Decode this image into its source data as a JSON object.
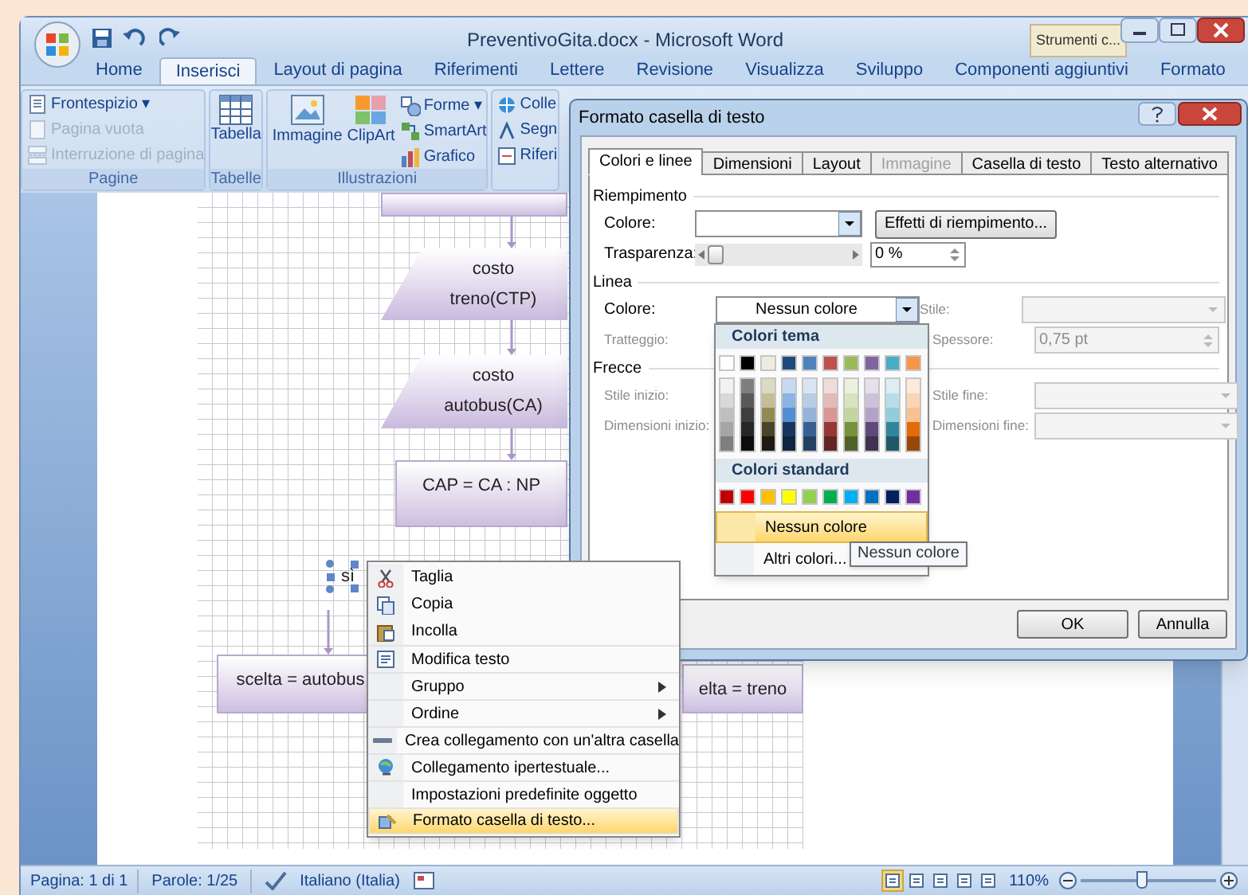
{
  "window": {
    "title": "PreventivoGita.docx - Microsoft Word",
    "contextual_tab": "Strumenti c..."
  },
  "ribbon_tabs": [
    {
      "label": "Home",
      "selected": false
    },
    {
      "label": "Inserisci",
      "selected": true
    },
    {
      "label": "Layout di pagina",
      "selected": false
    },
    {
      "label": "Riferimenti",
      "selected": false
    },
    {
      "label": "Lettere",
      "selected": false
    },
    {
      "label": "Revisione",
      "selected": false
    },
    {
      "label": "Visualizza",
      "selected": false
    },
    {
      "label": "Sviluppo",
      "selected": false
    },
    {
      "label": "Componenti aggiuntivi",
      "selected": false
    },
    {
      "label": "Formato",
      "selected": false
    }
  ],
  "ribbon_groups": [
    {
      "name": "Pagine",
      "items": [
        {
          "label": "Frontespizio ▾",
          "disabled": false
        },
        {
          "label": "Pagina vuota",
          "disabled": true
        },
        {
          "label": "Interruzione di pagina",
          "disabled": true
        }
      ]
    },
    {
      "name": "Tabelle",
      "items": [
        {
          "label": "Tabella"
        }
      ]
    },
    {
      "name": "Illustrazioni",
      "items": [
        {
          "label": "Immagine"
        },
        {
          "label": "ClipArt"
        },
        {
          "label": "Forme ▾"
        },
        {
          "label": "SmartArt"
        },
        {
          "label": "Grafico"
        }
      ]
    },
    {
      "items": [
        {
          "label": "Colle"
        },
        {
          "label": "Segn"
        },
        {
          "label": "Riferi"
        }
      ]
    }
  ],
  "document": {
    "shapes": [
      {
        "kind": "process"
      },
      {
        "kind": "input",
        "text": "costo treno(CTP)"
      },
      {
        "kind": "input",
        "text": "costo autobus(CA)"
      },
      {
        "kind": "process",
        "text": "CAP = CA : NP"
      },
      {
        "kind": "selected_label",
        "text": "sì"
      },
      {
        "kind": "process",
        "text": "scelta = autobus"
      },
      {
        "kind": "process",
        "text": "elta = treno"
      }
    ]
  },
  "dialog": {
    "title": "Formato casella di testo",
    "tabs": [
      {
        "label": "Colori e linee",
        "selected": true,
        "disabled": false
      },
      {
        "label": "Dimensioni",
        "selected": false,
        "disabled": false
      },
      {
        "label": "Layout",
        "selected": false,
        "disabled": false
      },
      {
        "label": "Immagine",
        "selected": false,
        "disabled": true
      },
      {
        "label": "Casella di testo",
        "selected": false,
        "disabled": false
      },
      {
        "label": "Testo alternativo",
        "selected": false,
        "disabled": false
      }
    ],
    "fill": {
      "heading": "Riempimento",
      "color_label": "Colore:",
      "effects_button": "Effetti di riempimento...",
      "transparency_label": "Trasparenza:",
      "transparency": {
        "level": 0
      },
      "transparency_value": "0 %"
    },
    "line": {
      "heading": "Linea",
      "color_label": "Colore:",
      "color_value": "Nessun colore",
      "dash_label": "Tratteggio:",
      "style_label": "Stile:",
      "weight_label": "Spessore:",
      "weight_value": "0,75 pt"
    },
    "arrows": {
      "heading": "Frecce",
      "begin_style_label": "Stile inizio:",
      "begin_size_label": "Dimensioni inizio:",
      "end_style_label": "Stile fine:",
      "end_size_label": "Dimensioni fine:"
    },
    "buttons": [
      "OK",
      "Annulla"
    ]
  },
  "color_picker": {
    "theme_heading": "Colori tema",
    "theme_colors": [
      {
        "color": "#ffffff"
      },
      {
        "color": "#000000"
      },
      {
        "color": "#eeece1"
      },
      {
        "color": "#1f497d"
      },
      {
        "color": "#4f81bd"
      },
      {
        "color": "#c0504d"
      },
      {
        "color": "#9bbb59"
      },
      {
        "color": "#8064a2"
      },
      {
        "color": "#4bacc6"
      },
      {
        "color": "#f79646"
      }
    ],
    "shade_columns": [
      [
        {
          "color": "#f2f2f2"
        },
        {
          "color": "#d8d8d8"
        },
        {
          "color": "#bfbfbf"
        },
        {
          "color": "#a5a5a5"
        },
        {
          "color": "#7f7f7f"
        }
      ],
      [
        {
          "color": "#7f7f7f"
        },
        {
          "color": "#595959"
        },
        {
          "color": "#3f3f3f"
        },
        {
          "color": "#262626"
        },
        {
          "color": "#0c0c0c"
        }
      ],
      [
        {
          "color": "#ddd9c3"
        },
        {
          "color": "#c4bd97"
        },
        {
          "color": "#938953"
        },
        {
          "color": "#494429"
        },
        {
          "color": "#1d1b10"
        }
      ],
      [
        {
          "color": "#c6d9f0"
        },
        {
          "color": "#8db3e2"
        },
        {
          "color": "#548dd4"
        },
        {
          "color": "#17365d"
        },
        {
          "color": "#0f243e"
        }
      ],
      [
        {
          "color": "#dbe5f1"
        },
        {
          "color": "#b8cce4"
        },
        {
          "color": "#95b3d7"
        },
        {
          "color": "#366092"
        },
        {
          "color": "#244061"
        }
      ],
      [
        {
          "color": "#f2dcdb"
        },
        {
          "color": "#e5b9b7"
        },
        {
          "color": "#d99694"
        },
        {
          "color": "#953734"
        },
        {
          "color": "#632423"
        }
      ],
      [
        {
          "color": "#ebf1dd"
        },
        {
          "color": "#d7e3bc"
        },
        {
          "color": "#c3d69b"
        },
        {
          "color": "#76923c"
        },
        {
          "color": "#4f6128"
        }
      ],
      [
        {
          "color": "#e5e0ec"
        },
        {
          "color": "#ccc1d9"
        },
        {
          "color": "#b2a2c7"
        },
        {
          "color": "#5f497a"
        },
        {
          "color": "#3f3151"
        }
      ],
      [
        {
          "color": "#dbeef3"
        },
        {
          "color": "#b7dde8"
        },
        {
          "color": "#92cddc"
        },
        {
          "color": "#31859b"
        },
        {
          "color": "#205867"
        }
      ],
      [
        {
          "color": "#fdeada"
        },
        {
          "color": "#fbd5b5"
        },
        {
          "color": "#fac08f"
        },
        {
          "color": "#e36c09"
        },
        {
          "color": "#974806"
        }
      ]
    ],
    "standard_heading": "Colori standard",
    "standard_colors": [
      {
        "color": "#c00000"
      },
      {
        "color": "#ff0000"
      },
      {
        "color": "#ffc000"
      },
      {
        "color": "#ffff00"
      },
      {
        "color": "#92d050"
      },
      {
        "color": "#00b050"
      },
      {
        "color": "#00b0f0"
      },
      {
        "color": "#0070c0"
      },
      {
        "color": "#002060"
      },
      {
        "color": "#7030a0"
      }
    ],
    "options": [
      {
        "label": "Nessun colore",
        "selected": true
      },
      {
        "label": "Altri colori...",
        "selected": false
      }
    ],
    "tooltip": "Nessun colore"
  },
  "context_menu": [
    {
      "label": "Taglia",
      "submenu": false,
      "selected": false
    },
    {
      "label": "Copia",
      "submenu": false,
      "selected": false
    },
    {
      "label": "Incolla",
      "submenu": false,
      "selected": false
    },
    {
      "label": "Modifica testo",
      "submenu": false,
      "selected": false
    },
    {
      "label": "Gruppo",
      "submenu": true,
      "selected": false
    },
    {
      "label": "Ordine",
      "submenu": true,
      "selected": false
    },
    {
      "label": "Crea collegamento con un'altra casella",
      "submenu": false,
      "selected": false
    },
    {
      "label": "Collegamento ipertestuale...",
      "submenu": false,
      "selected": false
    },
    {
      "label": "Impostazioni predefinite oggetto",
      "submenu": false,
      "selected": false
    },
    {
      "label": "Formato casella di testo...",
      "submenu": false,
      "selected": true
    }
  ],
  "status_bar": {
    "page": "Pagina: 1 di 1",
    "words": "Parole: 1/25",
    "language": "Italiano (Italia)",
    "views": [
      {
        "selected": true
      },
      {
        "selected": false
      },
      {
        "selected": false
      },
      {
        "selected": false
      },
      {
        "selected": false
      }
    ],
    "zoom": "110%",
    "zoom_slider": {
      "level": 0.45
    }
  }
}
